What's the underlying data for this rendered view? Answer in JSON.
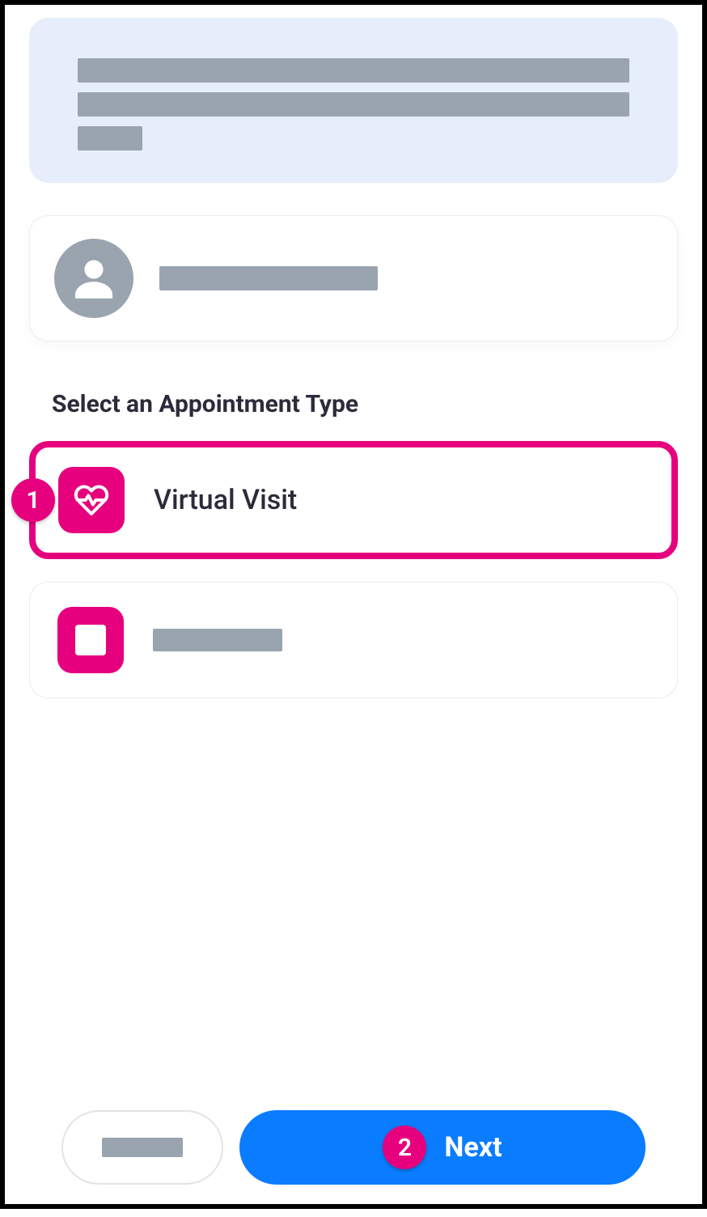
{
  "section_heading": "Select an Appointment Type",
  "appointment_types": [
    {
      "label": "Virtual Visit",
      "icon": "heart-pulse",
      "selected": true
    },
    {
      "label": "",
      "icon": "square",
      "selected": false
    }
  ],
  "buttons": {
    "next_label": "Next"
  },
  "callouts": {
    "option1": "1",
    "next": "2"
  },
  "colors": {
    "accent_pink": "#e6007e",
    "accent_blue": "#0a7cff",
    "placeholder_gray": "#9aa4af",
    "info_bg": "#e6edfb"
  }
}
